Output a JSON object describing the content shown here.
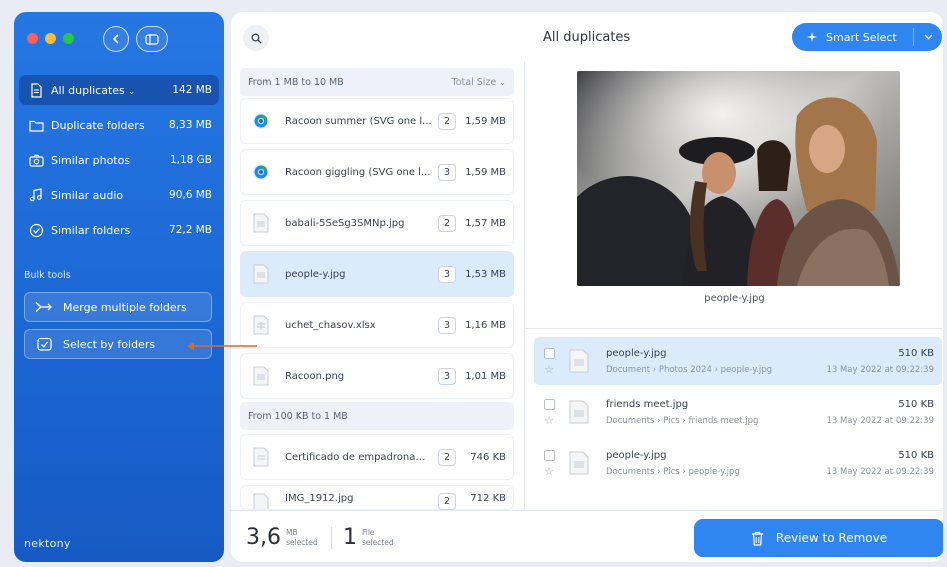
{
  "sidebar": {
    "items": [
      {
        "label": "All duplicates",
        "size": "142 MB",
        "icon": "document-icon"
      },
      {
        "label": "Duplicate folders",
        "size": "8,33 MB",
        "icon": "folder-icon"
      },
      {
        "label": "Similar photos",
        "size": "1,18 GB",
        "icon": "camera-icon"
      },
      {
        "label": "Similar audio",
        "size": "90,6 MB",
        "icon": "music-note-icon"
      },
      {
        "label": "Similar folders",
        "size": "72,2 MB",
        "icon": "folder-check-icon"
      }
    ],
    "bulk_tools_label": "Bulk tools",
    "merge_label": "Merge multiple folders",
    "select_label": "Select by folders",
    "brand": "nektony"
  },
  "header": {
    "title": "All duplicates",
    "smart_select_label": "Smart Select"
  },
  "groups": [
    {
      "label": "From 1 MB to 10 MB",
      "sort": "Total Size"
    },
    {
      "label": "From 100 KB to 1 MB"
    }
  ],
  "files": [
    {
      "name": "Racoon summer (SVG one l...",
      "count": "2",
      "size": "1,59 MB",
      "icon": "chrome-icon"
    },
    {
      "name": "Racoon giggling (SVG one l...",
      "count": "3",
      "size": "1,59 MB",
      "icon": "chrome-icon"
    },
    {
      "name": "babali-5SeSg3SMNp.jpg",
      "count": "2",
      "size": "1,57 MB",
      "icon": "image-file-icon"
    },
    {
      "name": "people-y.jpg",
      "count": "3",
      "size": "1,53 MB",
      "icon": "image-file-icon"
    },
    {
      "name": "uchet_chasov.xlsx",
      "count": "3",
      "size": "1,16 MB",
      "icon": "spreadsheet-file-icon"
    },
    {
      "name": "Racoon.png",
      "count": "3",
      "size": "1,01 MB",
      "icon": "image-file-icon"
    },
    {
      "name": "Certificado de empadronam...",
      "count": "2",
      "size": "746 KB",
      "icon": "document-file-icon"
    },
    {
      "name": "IMG_1912.jpg",
      "count": "2",
      "size": "712 KB",
      "icon": "image-file-icon"
    }
  ],
  "preview": {
    "caption": "people-y.jpg"
  },
  "duplicates": [
    {
      "name": "people-y.jpg",
      "path": "Document › Photos 2024 › people-y.jpg",
      "size": "510 KB",
      "date": "13 May 2022 at 09:22:39"
    },
    {
      "name": "friends meet.jpg",
      "path": "Documents › Pics › friends meet.jpg",
      "size": "510 KB",
      "date": "13 May 2022 at 09:22:39"
    },
    {
      "name": "people-y.jpg",
      "path": "Documents › Pics › people-y.jpg",
      "size": "510 KB",
      "date": "13 May 2022 at 09:22:39"
    }
  ],
  "footer": {
    "size_value": "3,6",
    "size_unit": "MB",
    "size_sub": "selected",
    "file_count": "1",
    "file_unit": "File",
    "file_sub": "selected",
    "review_label": "Review to Remove"
  },
  "colors": {
    "accent": "#2f86f0",
    "sidebar": "#1b66d3",
    "annotation_arrow": "#e0692a"
  }
}
